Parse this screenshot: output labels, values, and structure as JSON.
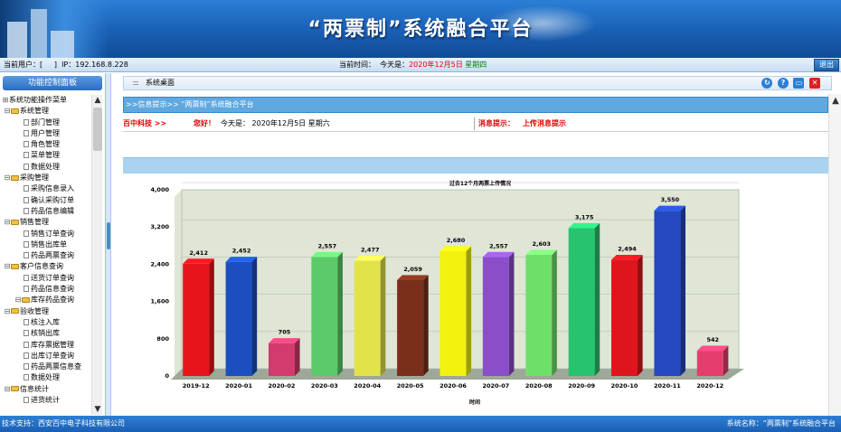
{
  "header": {
    "title": "“两票制”系统融合平台"
  },
  "userbar": {
    "user_label": "当前用户：[",
    "user_close": "]",
    "ip_label": "IP：",
    "ip": "192.168.8.228",
    "time_label": "当前时间：",
    "today_label": "今天是：",
    "date": "2020年12月5日",
    "weekday": "星期四"
  },
  "logout_label": "退出",
  "sidebar": {
    "title": "功能控制面板",
    "root": "系统功能操作菜单",
    "groups": [
      {
        "label": "系统管理",
        "items": [
          "部门管理",
          "用户管理",
          "角色管理",
          "菜单管理",
          "数据处理"
        ]
      },
      {
        "label": "采购管理",
        "items": [
          "采购信息录入",
          "确认采购订单",
          "药品信息编辑"
        ]
      },
      {
        "label": "销售管理",
        "items": [
          "销售订单查询",
          "销售出库单",
          "药品两票查询"
        ]
      },
      {
        "label": "客户信息查询",
        "items": [
          "送货订单查询",
          "药品信息查询"
        ],
        "subgroup": "库存药品查询"
      },
      {
        "label": "验收管理",
        "items": [
          "核注入库",
          "核销出库",
          "库存票据管理",
          "出库订单查询",
          "药品两票信息查",
          "数据处理"
        ]
      },
      {
        "label": "信息统计",
        "items": [
          "进货统计"
        ]
      }
    ]
  },
  "main": {
    "breadcrumb": "系统桌面",
    "info_head": ">>信息提示>> “两票制”系统融合平台",
    "news": {
      "company": "百中科技 >>",
      "greeting": "您好！",
      "date_text": "今天是：  2020年12月5日 星期六",
      "msg_label": "消息提示：",
      "msg_text": "上传消息提示"
    }
  },
  "chart_data": {
    "type": "bar",
    "title": "过去12个月两票上传情况",
    "xlabel": "时间",
    "ylabel": "",
    "ylim": [
      0,
      4000
    ],
    "y_ticks": [
      "0",
      "800",
      "1,600",
      "2,400",
      "3,200",
      "4,000"
    ],
    "categories": [
      "2019-12",
      "2020-01",
      "2020-02",
      "2020-03",
      "2020-04",
      "2020-05",
      "2020-06",
      "2020-07",
      "2020-08",
      "2020-09",
      "2020-10",
      "2020-11",
      "2020-12"
    ],
    "values": [
      2412,
      2452,
      705,
      2557,
      2477,
      2059,
      2680,
      2557,
      2603,
      3175,
      2494,
      3550,
      542
    ],
    "labels": [
      "2,412",
      "2,452",
      "705",
      "2,557",
      "2,477",
      "2,059",
      "2,680",
      "2,557",
      "2,603",
      "3,175",
      "2,494",
      "3,550",
      "542"
    ],
    "colors": [
      "#e8141c",
      "#1b4fc0",
      "#d33a6e",
      "#5cc96a",
      "#e2e24a",
      "#7a2f1a",
      "#f2f20e",
      "#8a4fc8",
      "#6ee06a",
      "#27c470",
      "#e0141c",
      "#2348c0",
      "#e53e6e"
    ],
    "grid": true,
    "background": "#dfe6d6"
  },
  "footer": {
    "left": "技术支持：西安百中电子科技有限公司",
    "right": "系统名称：“两票制”系统融合平台"
  }
}
